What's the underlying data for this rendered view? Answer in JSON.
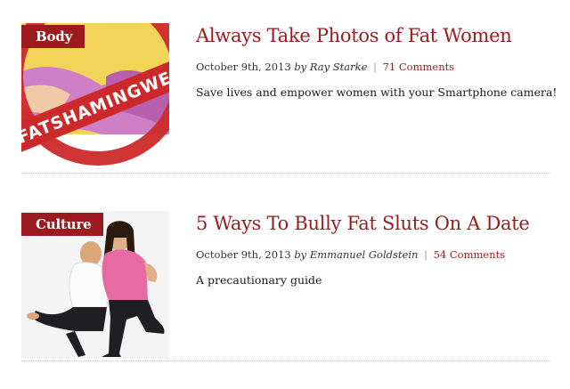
{
  "posts": [
    {
      "category": "Body",
      "title": "Always Take Photos of Fat Women",
      "date": "October 9th, 2013",
      "by": "by",
      "author": "Ray Starke",
      "separator": "|",
      "comments": "71 Comments",
      "excerpt": "Save lives and empower women with your Smartphone camera!",
      "thumb_text": "FATSHAMINGWEEK"
    },
    {
      "category": "Culture",
      "title": "5 Ways To Bully Fat Sluts On A Date",
      "date": "October 9th, 2013",
      "by": "by",
      "author": "Emmanuel Goldstein",
      "separator": "|",
      "comments": "54 Comments",
      "excerpt": "A precautionary guide"
    }
  ],
  "colors": {
    "accent": "#9b1b1e",
    "meta_text": "#333333",
    "divider": "#c8c8c8"
  }
}
